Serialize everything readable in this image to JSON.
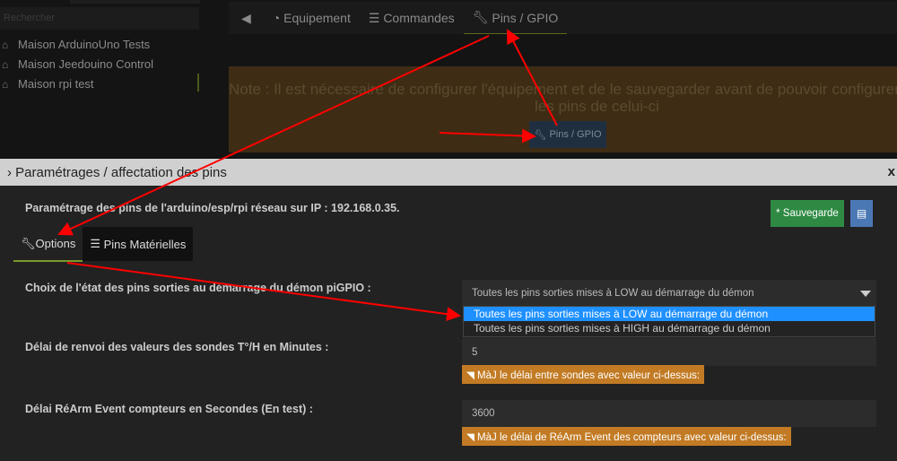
{
  "sidebar": {
    "search_placeholder": "Rechercher",
    "items": [
      {
        "label": "Maison ArduinoUno Tests"
      },
      {
        "label": "Maison Jeedouino Control"
      },
      {
        "label": "Maison rpi test"
      }
    ]
  },
  "nav": {
    "tabs": [
      {
        "label": "Equipement"
      },
      {
        "label": "Commandes"
      },
      {
        "label": "Pins / GPIO"
      }
    ]
  },
  "note": {
    "line1": "Note : Il est nécessaire de configurer l'équipement et de le sauvegarder avant de pouvoir configurer",
    "line2": "les pins de celui-ci",
    "button": "Pins / GPIO"
  },
  "modal": {
    "title": "Paramétrages / affectation des pins",
    "close": "x",
    "ip_text": "Paramétrage des pins de l'arduino/esp/rpi réseau sur IP : 192.168.0.35.",
    "save_label": "* Sauvegarde",
    "tabs": [
      {
        "label": "Options"
      },
      {
        "label": "Pins Matérielles"
      }
    ],
    "fields": {
      "startup_label": "Choix de l'état des pins sorties au démarrage du démon piGPIO :",
      "startup_value": "Toutes les pins sorties mises à LOW au démarrage du démon",
      "startup_options": [
        "Toutes les pins sorties mises à LOW au démarrage du démon",
        "Toutes les pins sorties mises à HIGH au démarrage du démon"
      ],
      "probe_label": "Délai de renvoi des valeurs des sondes T°/H en Minutes :",
      "probe_value": "5",
      "probe_button": "MàJ le délai entre sondes avec valeur ci-dessus:",
      "rearm_label": "Délai RéArm Event compteurs en Secondes (En test) :",
      "rearm_value": "3600",
      "rearm_button": "MàJ le délai de RéArm Event des compteurs avec valeur ci-dessus:"
    }
  },
  "colors": {
    "accent": "#7a9a2a",
    "save": "#2e8a43",
    "orange": "#c27b24",
    "select": "#1e90ff",
    "annotation": "#ff0000"
  }
}
